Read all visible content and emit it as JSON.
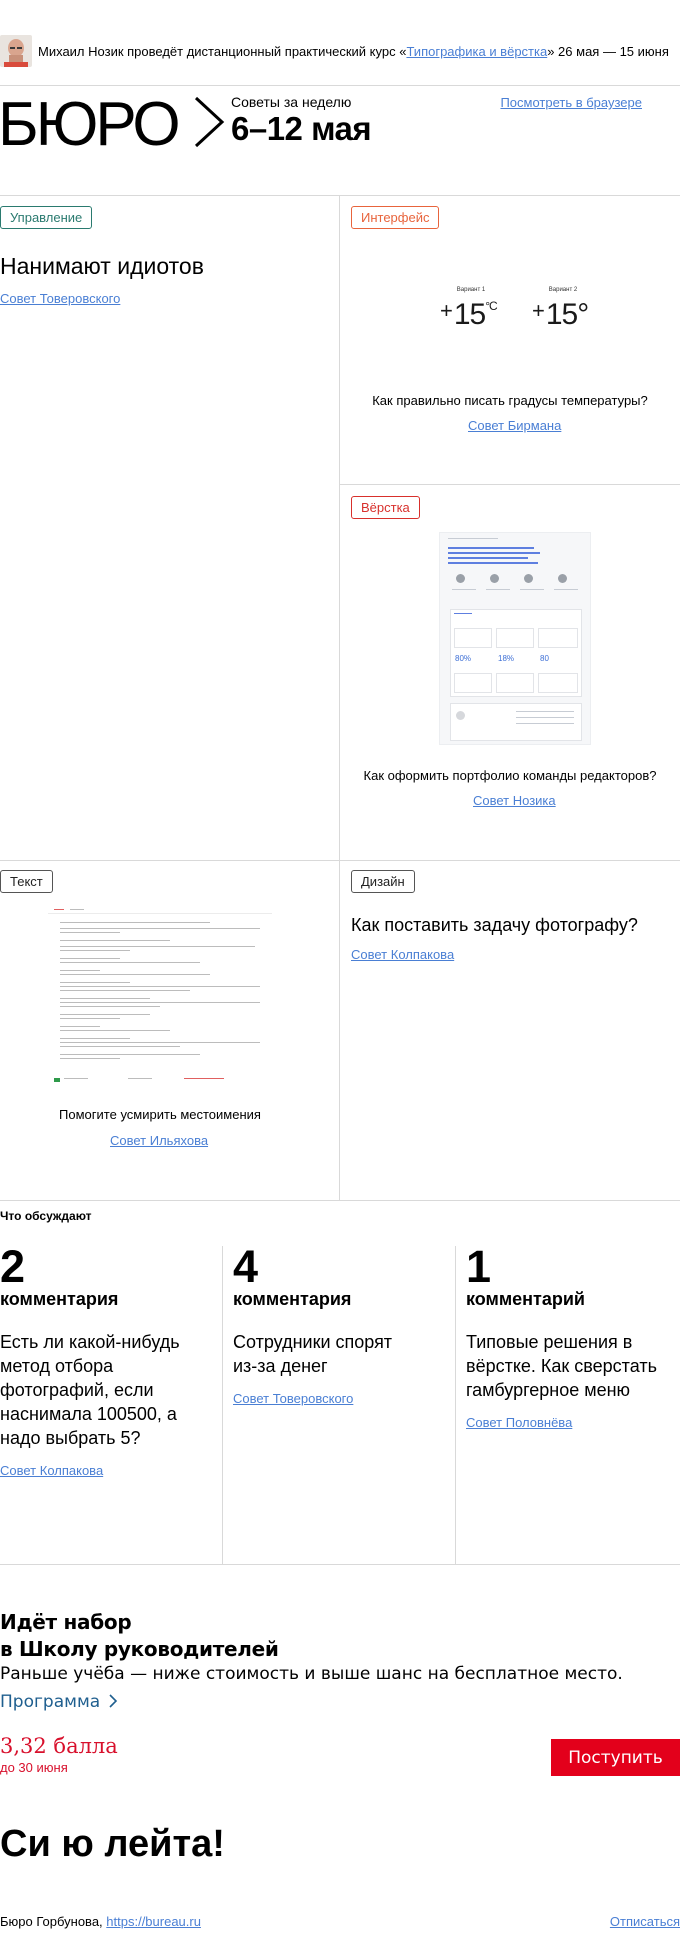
{
  "banner": {
    "text_before": "Михаил Нозик проведёт дистанционный практический курс «",
    "course_link": "Типографика и вёрстка",
    "text_after": "» 26 мая — 15 июня"
  },
  "header": {
    "logo_text": "БЮРО",
    "week_label": "Советы за неделю",
    "week_range": "6–12 мая",
    "browser_link": "Посмотреть в браузере"
  },
  "cards": {
    "management": {
      "tag": "Управление",
      "title": "Нанимают идиотов",
      "link": "Совет Товеровского"
    },
    "interface": {
      "tag": "Интерфейс",
      "variant1_label": "Вариант 1",
      "variant1_value": "15",
      "variant1_unit": "°C",
      "variant2_label": "Вариант 2",
      "variant2_value": "15°",
      "plus": "+",
      "caption": "Как правильно писать градусы температуры?",
      "link": "Совет Бирмана"
    },
    "layout": {
      "tag": "Вёрстка",
      "caption": "Как оформить портфолио команды редакторов?",
      "link": "Совет Нозика",
      "mock_stats": [
        "80%",
        "18%",
        "80"
      ]
    },
    "text": {
      "tag": "Текст",
      "caption": "Помогите усмирить местоимения",
      "link": "Совет Ильяхова"
    },
    "design": {
      "tag": "Дизайн",
      "title": "Как поставить задачу фотографу?",
      "link": "Совет Колпакова"
    }
  },
  "discussed": {
    "title": "Что обсуждают",
    "items": [
      {
        "count": "2",
        "word": "комментария",
        "question": "Есть ли какой-нибудь метод отбора фотографий, если наснимала 100500, а надо выбрать 5?",
        "link": "Совет Колпакова"
      },
      {
        "count": "4",
        "word": "комментария",
        "question": "Сотрудники спорят из-за денег",
        "link": "Совет Товеровского"
      },
      {
        "count": "1",
        "word": "комментарий",
        "question": "Типовые решения в вёрстке. Как сверстать гамбургерное меню",
        "link": "Совет Половнёва"
      }
    ]
  },
  "school": {
    "title_line1": "Идёт набор",
    "title_line2": "в Школу руководителей",
    "subtitle": "Раньше учёба — ниже стоимость и выше шанс на бесплатное место.",
    "program": "Программа",
    "score": "3,32 балла",
    "score_date": "до 30 июня",
    "apply": "Поступить"
  },
  "closing": "Си ю лейта!",
  "footer": {
    "left_text": "Бюро Горбунова, ",
    "left_link": "https://bureau.ru",
    "unsubscribe": "Отписаться"
  },
  "colors": {
    "link": "#4a7fd4",
    "tag_management": "#2a7a6f",
    "tag_interface": "#e8643c",
    "tag_layout": "#d8302c",
    "accent_red": "#e3001b",
    "program_blue": "#1f5f8f"
  }
}
